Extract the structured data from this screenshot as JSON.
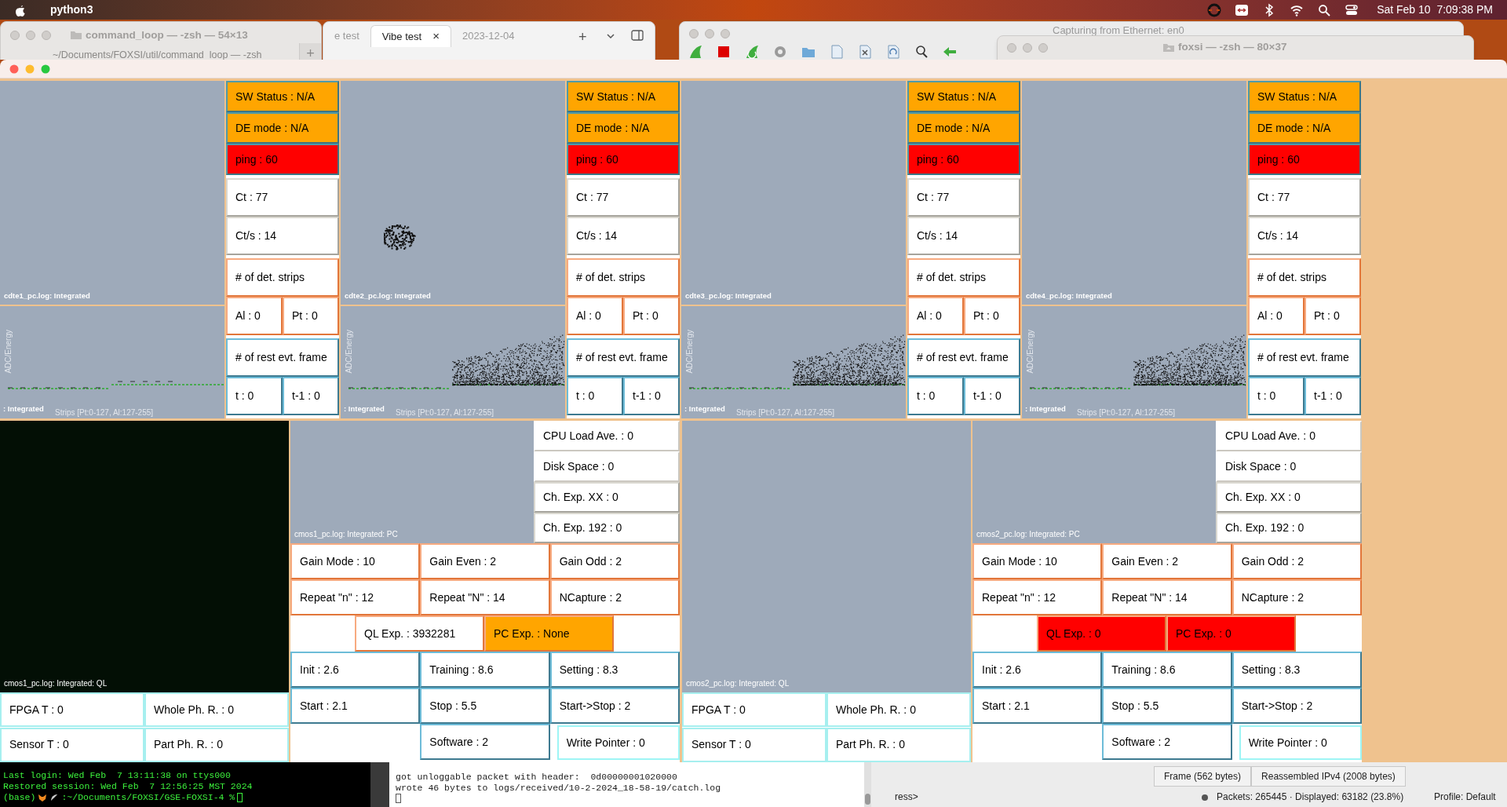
{
  "menubar": {
    "app": "python3",
    "clock": "Sat Feb 10  7:09:38 PM"
  },
  "background_windows": {
    "terminal": {
      "title": "command_loop — -zsh — 54×13",
      "path": "~/Documents/FOXSI/util/command_loop — -zsh",
      "new_tab": "+"
    },
    "browser": {
      "tabs": [
        {
          "label": "e test",
          "selected": false
        },
        {
          "label": "Vibe test",
          "selected": true
        },
        {
          "label": "2023-12-04",
          "selected": false
        }
      ],
      "close": "×",
      "new_tab": "+"
    },
    "wireshark": {
      "title": "Capturing from Ethernet: en0"
    },
    "foxsi_terminal": {
      "title": "foxsi — -zsh — 80×37"
    }
  },
  "cdte_panels": [
    {
      "image_label": "cdte1_pc.log: Integrated",
      "spectrum_label": ": Integrated",
      "y_axis": "ADC/Energy",
      "x_axis": "Strips [Pt:0-127, Al:127-255]",
      "hit_cluster": false,
      "band": false,
      "status": [
        {
          "text": "SW Status : N/A",
          "color": "#ffa500"
        },
        {
          "text": "DE mode : N/A",
          "color": "#ffa500"
        },
        {
          "text": "ping : 60",
          "color": "#ff0000"
        }
      ],
      "counts": [
        "Ct : 77",
        "Ct/s : 14"
      ],
      "strips": "# of det. strips",
      "strip_split": [
        "Al : 0",
        "Pt : 0"
      ],
      "frames": "# of rest evt. frame",
      "frame_split": [
        "t : 0",
        "t-1 : 0"
      ]
    },
    {
      "image_label": "cdte2_pc.log: Integrated",
      "spectrum_label": ": Integrated",
      "y_axis": "ADC/Energy",
      "x_axis": "Strips [Pt:0-127, Al:127-255]",
      "hit_cluster": true,
      "band": true,
      "status": [
        {
          "text": "SW Status : N/A",
          "color": "#ffa500"
        },
        {
          "text": "DE mode : N/A",
          "color": "#ffa500"
        },
        {
          "text": "ping : 60",
          "color": "#ff0000"
        }
      ],
      "counts": [
        "Ct : 77",
        "Ct/s : 14"
      ],
      "strips": "# of det. strips",
      "strip_split": [
        "Al : 0",
        "Pt : 0"
      ],
      "frames": "# of rest evt. frame",
      "frame_split": [
        "t : 0",
        "t-1 : 0"
      ]
    },
    {
      "image_label": "cdte3_pc.log: Integrated",
      "spectrum_label": ": Integrated",
      "y_axis": "ADC/Energy",
      "x_axis": "Strips [Pt:0-127, Al:127-255]",
      "hit_cluster": false,
      "band": true,
      "status": [
        {
          "text": "SW Status : N/A",
          "color": "#ffa500"
        },
        {
          "text": "DE mode : N/A",
          "color": "#ffa500"
        },
        {
          "text": "ping : 60",
          "color": "#ff0000"
        }
      ],
      "counts": [
        "Ct : 77",
        "Ct/s : 14"
      ],
      "strips": "# of det. strips",
      "strip_split": [
        "Al : 0",
        "Pt : 0"
      ],
      "frames": "# of rest evt. frame",
      "frame_split": [
        "t : 0",
        "t-1 : 0"
      ]
    },
    {
      "image_label": "cdte4_pc.log: Integrated",
      "spectrum_label": ": Integrated",
      "y_axis": "ADC/Energy",
      "x_axis": "Strips [Pt:0-127, Al:127-255]",
      "hit_cluster": false,
      "band": true,
      "status": [
        {
          "text": "SW Status : N/A",
          "color": "#ffa500"
        },
        {
          "text": "DE mode : N/A",
          "color": "#ffa500"
        },
        {
          "text": "ping : 60",
          "color": "#ff0000"
        }
      ],
      "counts": [
        "Ct : 77",
        "Ct/s : 14"
      ],
      "strips": "# of det. strips",
      "strip_split": [
        "Al : 0",
        "Pt : 0"
      ],
      "frames": "# of rest evt. frame",
      "frame_split": [
        "t : 0",
        "t-1 : 0"
      ]
    }
  ],
  "cmos_panels": [
    {
      "ql_image": {
        "label": "cmos1_pc.log: Integrated: QL",
        "dark": true
      },
      "readouts": [
        "FPGA T : 0",
        "Whole Ph. R. : 0",
        "Sensor T : 0",
        "Part Ph. R. : 0"
      ],
      "pc_image_label": "cmos1_pc.log: Integrated: PC",
      "system": [
        "CPU Load Ave. : 0",
        "Disk Space : 0",
        "Ch. Exp. XX : 0",
        "Ch. Exp. 192 : 0"
      ],
      "gain": [
        "Gain Mode : 10",
        "Gain Even : 2",
        "Gain Odd : 2",
        "Repeat \"n\" : 12",
        "Repeat \"N\" : 14",
        "NCapture : 2"
      ],
      "exposure": [
        {
          "text": "QL Exp. : 3932281",
          "color": "#ffffff"
        },
        {
          "text": "PC Exp. : None",
          "color": "#ffa500"
        }
      ],
      "timing": [
        "Init : 2.6",
        "Training : 8.6",
        "Setting : 8.3",
        "Start : 2.1",
        "Stop : 5.5",
        "Start->Stop : 2"
      ],
      "software": "Software : 2",
      "write_pointer": "Write Pointer : 0"
    },
    {
      "ql_image": {
        "label": "cmos2_pc.log: Integrated: QL",
        "dark": false
      },
      "readouts": [
        "FPGA T : 0",
        "Whole Ph. R. : 0",
        "Sensor T : 0",
        "Part Ph. R. : 0"
      ],
      "pc_image_label": "cmos2_pc.log: Integrated: PC",
      "system": [
        "CPU Load Ave. : 0",
        "Disk Space : 0",
        "Ch. Exp. XX : 0",
        "Ch. Exp. 192 : 0"
      ],
      "gain": [
        "Gain Mode : 10",
        "Gain Even : 2",
        "Gain Odd : 2",
        "Repeat \"n\" : 12",
        "Repeat \"N\" : 14",
        "NCapture : 2"
      ],
      "exposure": [
        {
          "text": "QL Exp. : 0",
          "color": "#ff0000"
        },
        {
          "text": "PC Exp. : 0",
          "color": "#ff0000"
        }
      ],
      "timing": [
        "Init : 2.6",
        "Training : 8.6",
        "Setting : 8.3",
        "Start : 2.1",
        "Stop : 5.5",
        "Start->Stop : 2"
      ],
      "software": "Software : 2",
      "write_pointer": "Write Pointer : 0"
    }
  ],
  "bottom": {
    "terminal_left": {
      "lines": [
        "Last login: Wed Feb  7 13:11:38 on ttys000",
        "Restored session: Wed Feb  7 12:56:25 MST 2024"
      ],
      "prompt_env": "(base)",
      "prompt_path": ":~/Documents/FOXSI/GSE-FOXSI-4 %"
    },
    "terminal_middle": {
      "lines": [
        "got unloggable packet with header:  0d00000001020000",
        "wrote 46 bytes to logs/received/10-2-2024_18-58-19/catch.log"
      ]
    },
    "wireshark": {
      "prompt": "ress>",
      "tabs": [
        "Frame (562 bytes)",
        "Reassembled IPv4 (2008 bytes)"
      ],
      "packets": "Packets: 265445 · Displayed: 63182 (23.8%)",
      "profile": "Profile: Default"
    }
  }
}
